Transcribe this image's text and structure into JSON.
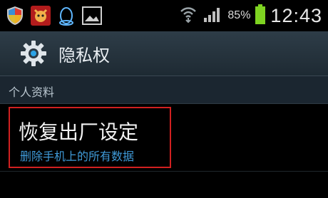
{
  "statusbar": {
    "battery_percent": "85%",
    "time": "12:43",
    "icons": [
      "shield-icon",
      "app-icon",
      "qq-penguin-icon",
      "image-icon",
      "wifi-icon",
      "signal-icon",
      "battery-icon"
    ],
    "battery_level": 0.85
  },
  "title_bar": {
    "title": "隐私权",
    "icon": "gear-icon"
  },
  "section": {
    "label": "个人资料"
  },
  "items": [
    {
      "title": "恢复出厂设定",
      "subtitle": "删除手机上的所有数据",
      "highlight_color": "#d12020"
    }
  ],
  "colors": {
    "accent": "#3f9ad8",
    "battery": "#7ed321"
  }
}
